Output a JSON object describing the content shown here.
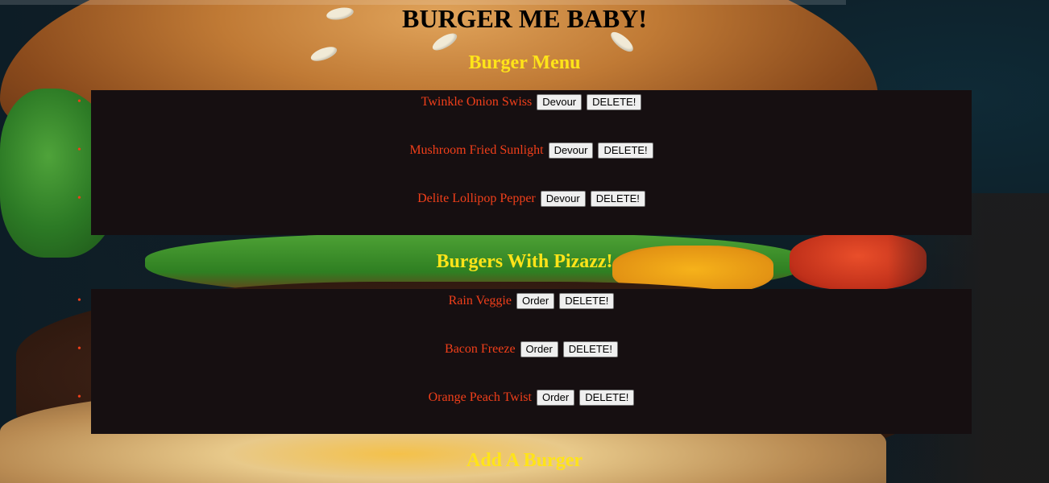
{
  "page": {
    "title": "BURGER ME BABY!"
  },
  "menu_section": {
    "heading": "Burger Menu",
    "action_label": "Devour",
    "delete_label": "DELETE!",
    "items": [
      {
        "name": "Twinkle Onion Swiss"
      },
      {
        "name": "Mushroom Fried Sunlight"
      },
      {
        "name": "Delite Lollipop Pepper"
      }
    ]
  },
  "pizazz_section": {
    "heading": "Burgers With Pizazz!",
    "action_label": "Order",
    "delete_label": "DELETE!",
    "items": [
      {
        "name": "Rain Veggie"
      },
      {
        "name": "Bacon Freeze"
      },
      {
        "name": "Orange Peach Twist"
      }
    ]
  },
  "add_section": {
    "heading": "Add A Burger"
  },
  "colors": {
    "heading_yellow": "#ffe419",
    "item_red": "#f13f1a",
    "panel_bg": "#160f11"
  }
}
